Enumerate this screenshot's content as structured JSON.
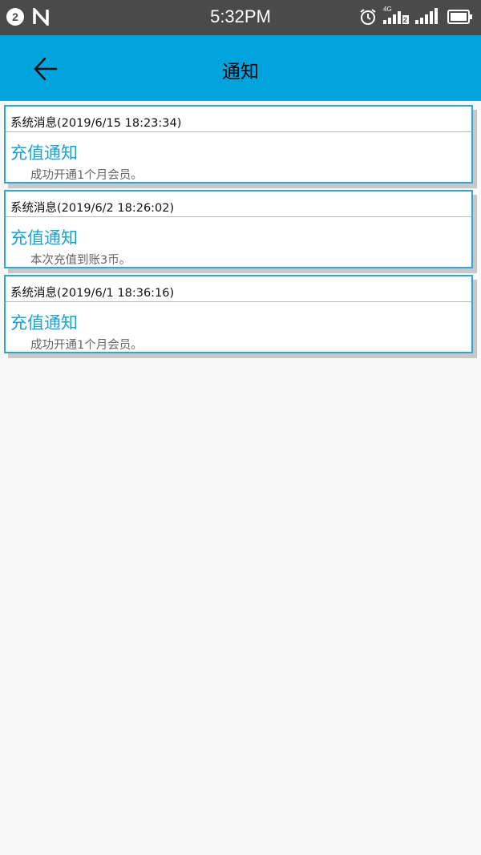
{
  "status_bar": {
    "badge": "2",
    "time": "5:32PM",
    "net_label": "4G",
    "sim_label": "2",
    "icons": [
      "notification-count-icon",
      "n-logo-icon",
      "alarm-icon",
      "signal-4g-icon",
      "signal-icon",
      "battery-icon"
    ]
  },
  "app_bar": {
    "title": "通知",
    "back_icon": "arrow-left-icon",
    "color": "#00a3dc"
  },
  "notifications": [
    {
      "header": "系统消息(2019/6/15 18:23:34)",
      "title": "充值通知",
      "body": "成功开通1个月会员。"
    },
    {
      "header": "系统消息(2019/6/2 18:26:02)",
      "title": "充值通知",
      "body": "本次充值到账3币。"
    },
    {
      "header": "系统消息(2019/6/1 18:36:16)",
      "title": "充值通知",
      "body": "成功开通1个月会员。"
    }
  ],
  "colors": {
    "accent": "#19a3d6",
    "card_border": "#2ba7dc",
    "status_bar": "#4a4a4a"
  }
}
